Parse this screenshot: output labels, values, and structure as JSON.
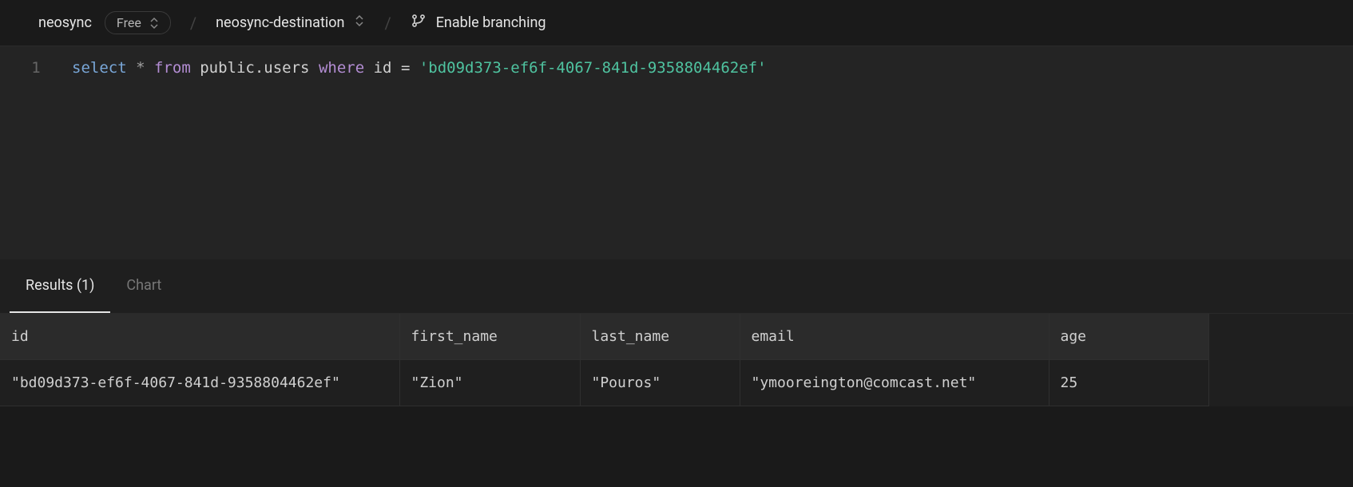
{
  "header": {
    "project": "neosync",
    "plan_badge": "Free",
    "branch": "neosync-destination",
    "branching_label": "Enable branching"
  },
  "editor": {
    "line_number": "1",
    "sql": {
      "select": "select",
      "star": "*",
      "from": "from",
      "table": "public.users",
      "where": "where",
      "column": "id",
      "op": "=",
      "value": "'bd09d373-ef6f-4067-841d-9358804462ef'"
    }
  },
  "tabs": {
    "results": "Results (1)",
    "chart": "Chart"
  },
  "table": {
    "headers": {
      "id": "id",
      "first_name": "first_name",
      "last_name": "last_name",
      "email": "email",
      "age": "age"
    },
    "rows": [
      {
        "id": "\"bd09d373-ef6f-4067-841d-9358804462ef\"",
        "first_name": "\"Zion\"",
        "last_name": "\"Pouros\"",
        "email": "\"ymooreington@comcast.net\"",
        "age": "25"
      }
    ]
  }
}
